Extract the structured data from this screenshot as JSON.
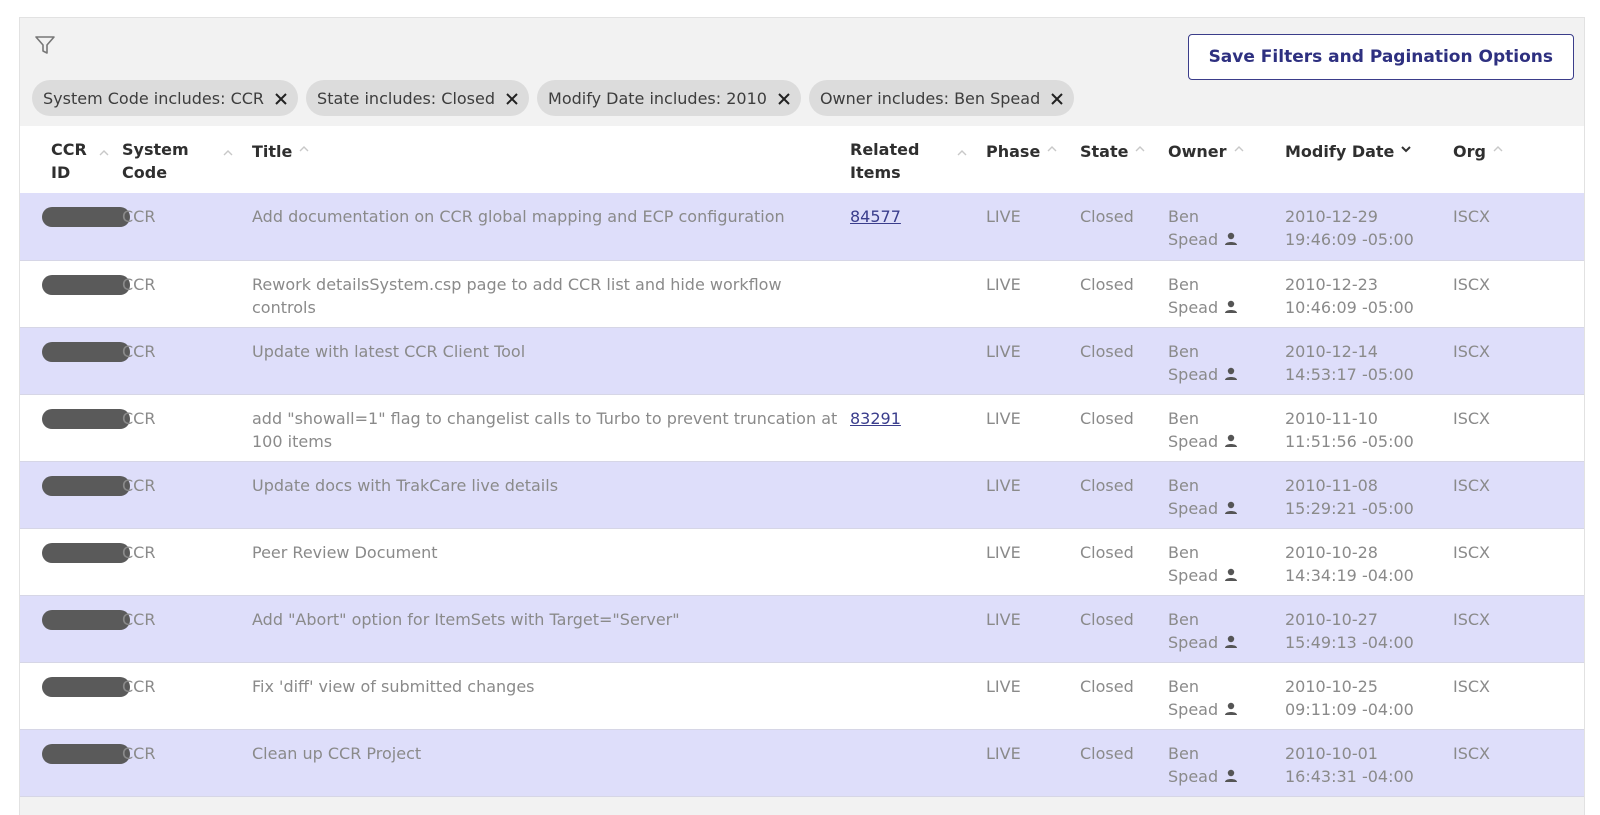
{
  "toolbar": {
    "save_label": "Save Filters and Pagination Options"
  },
  "filters": [
    {
      "label": "System Code includes: CCR"
    },
    {
      "label": "State includes: Closed"
    },
    {
      "label": "Modify Date includes: 2010"
    },
    {
      "label": "Owner includes: Ben Spead"
    }
  ],
  "columns": {
    "ccr_id": "CCR ID",
    "system_code": "System Code",
    "title": "Title",
    "related": "Related Items",
    "phase": "Phase",
    "state": "State",
    "owner": "Owner",
    "modify_date": "Modify Date",
    "org": "Org"
  },
  "rows": [
    {
      "system_code": "CCR",
      "title": "Add documentation on CCR global mapping and ECP configuration",
      "related": "84577",
      "phase": "LIVE",
      "state": "Closed",
      "owner_first": "Ben",
      "owner_last": "Spead",
      "date": "2010-12-29",
      "time": "19:46:09 -05:00",
      "org": "ISCX"
    },
    {
      "system_code": "CCR",
      "title": "Rework detailsSystem.csp page to add CCR list and hide workflow controls",
      "related": "",
      "phase": "LIVE",
      "state": "Closed",
      "owner_first": "Ben",
      "owner_last": "Spead",
      "date": "2010-12-23",
      "time": "10:46:09 -05:00",
      "org": "ISCX"
    },
    {
      "system_code": "CCR",
      "title": "Update with latest CCR Client Tool",
      "related": "",
      "phase": "LIVE",
      "state": "Closed",
      "owner_first": "Ben",
      "owner_last": "Spead",
      "date": "2010-12-14",
      "time": "14:53:17 -05:00",
      "org": "ISCX"
    },
    {
      "system_code": "CCR",
      "title": "add \"showall=1\" flag to changelist calls to Turbo to prevent truncation at 100 items",
      "related": "83291",
      "phase": "LIVE",
      "state": "Closed",
      "owner_first": "Ben",
      "owner_last": "Spead",
      "date": "2010-11-10",
      "time": "11:51:56 -05:00",
      "org": "ISCX"
    },
    {
      "system_code": "CCR",
      "title": "Update docs with TrakCare live details",
      "related": "",
      "phase": "LIVE",
      "state": "Closed",
      "owner_first": "Ben",
      "owner_last": "Spead",
      "date": "2010-11-08",
      "time": "15:29:21 -05:00",
      "org": "ISCX"
    },
    {
      "system_code": "CCR",
      "title": "Peer Review Document",
      "related": "",
      "phase": "LIVE",
      "state": "Closed",
      "owner_first": "Ben",
      "owner_last": "Spead",
      "date": "2010-10-28",
      "time": "14:34:19 -04:00",
      "org": "ISCX"
    },
    {
      "system_code": "CCR",
      "title": "Add \"Abort\" option for ItemSets with Target=\"Server\"",
      "related": "",
      "phase": "LIVE",
      "state": "Closed",
      "owner_first": "Ben",
      "owner_last": "Spead",
      "date": "2010-10-27",
      "time": "15:49:13 -04:00",
      "org": "ISCX"
    },
    {
      "system_code": "CCR",
      "title": "Fix 'diff' view of submitted changes",
      "related": "",
      "phase": "LIVE",
      "state": "Closed",
      "owner_first": "Ben",
      "owner_last": "Spead",
      "date": "2010-10-25",
      "time": "09:11:09 -04:00",
      "org": "ISCX"
    },
    {
      "system_code": "CCR",
      "title": "Clean up CCR Project",
      "related": "",
      "phase": "LIVE",
      "state": "Closed",
      "owner_first": "Ben",
      "owner_last": "Spead",
      "date": "2010-10-01",
      "time": "16:43:31 -04:00",
      "org": "ISCX"
    }
  ]
}
